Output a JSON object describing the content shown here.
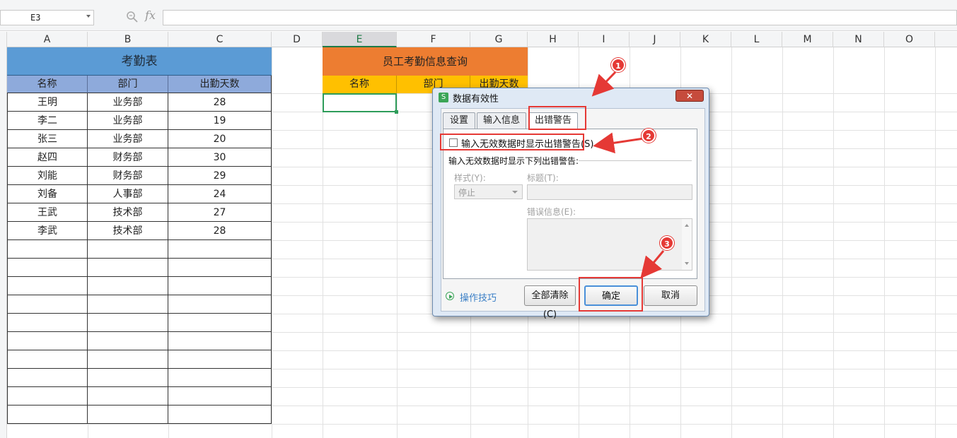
{
  "formula_bar": {
    "name_box": "E3",
    "fx": "fx",
    "formula": ""
  },
  "columns": [
    "A",
    "B",
    "C",
    "D",
    "E",
    "F",
    "G",
    "H",
    "I",
    "J",
    "K",
    "L",
    "M",
    "N",
    "O"
  ],
  "selected_column": "E",
  "attendance_table": {
    "title": "考勤表",
    "headers": [
      "名称",
      "部门",
      "出勤天数"
    ],
    "rows": [
      [
        "王明",
        "业务部",
        "28"
      ],
      [
        "李二",
        "业务部",
        "19"
      ],
      [
        "张三",
        "业务部",
        "20"
      ],
      [
        "赵四",
        "财务部",
        "30"
      ],
      [
        "刘能",
        "财务部",
        "29"
      ],
      [
        "刘备",
        "人事部",
        "24"
      ],
      [
        "王武",
        "技术部",
        "27"
      ],
      [
        "李武",
        "技术部",
        "28"
      ]
    ]
  },
  "query_table": {
    "title": "员工考勤信息查询",
    "headers": [
      "名称",
      "部门",
      "出勤天数"
    ]
  },
  "dialog": {
    "title": "数据有效性",
    "tabs": [
      "设置",
      "输入信息",
      "出错警告"
    ],
    "active_tab": "出错警告",
    "checkbox_label": "输入无效数据时显示出错警告(S)",
    "checkbox_checked": false,
    "section_label": "输入无效数据时显示下列出错警告:",
    "style_label": "样式(Y):",
    "style_value": "停止",
    "title_label": "标题(T):",
    "title_value": "",
    "error_label": "错误信息(E):",
    "error_value": "",
    "tips_label": "操作技巧",
    "clear_button": "全部清除(C)",
    "ok_button": "确定",
    "cancel_button": "取消"
  },
  "annotations": [
    "1",
    "2",
    "3"
  ],
  "colors": {
    "accent_red": "#e53935",
    "title_blue": "#5b9bd5",
    "title_orange": "#ed7d31",
    "header_yellow": "#ffc000"
  }
}
